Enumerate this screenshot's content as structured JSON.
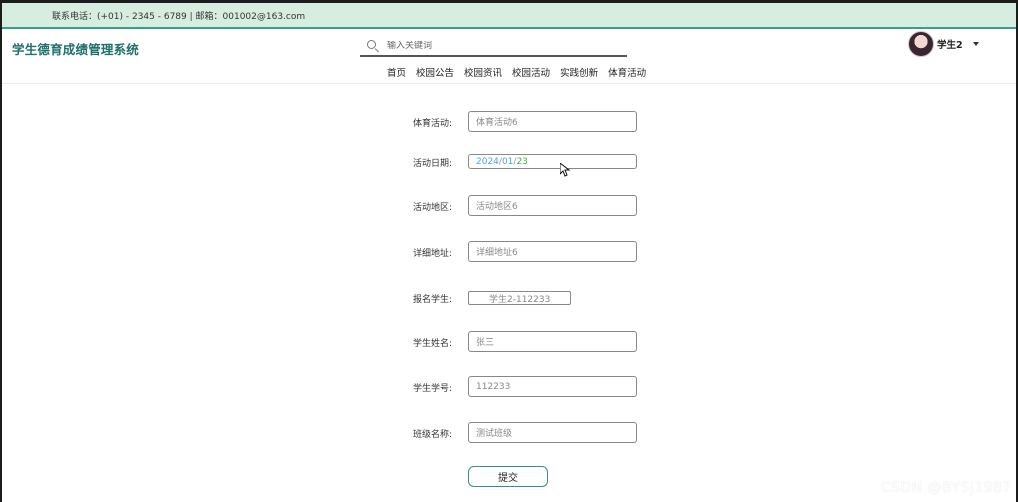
{
  "topbar": {
    "contact": "联系电话：(+01) - 2345 - 6789 | 邮箱：001002@163.com"
  },
  "header": {
    "logo": "学生德育成绩管理系统",
    "search_placeholder": "输入关键词",
    "username": "学生2"
  },
  "nav": [
    "首页",
    "校园公告",
    "校园资讯",
    "校园活动",
    "实践创新",
    "体育活动"
  ],
  "form": {
    "fields": [
      {
        "label": "体育活动:",
        "value": "体育活动6"
      },
      {
        "label": "活动日期:",
        "date": {
          "year": "2024",
          "sep1": "/",
          "month": "01",
          "sep2": "/",
          "day": "23"
        }
      },
      {
        "label": "活动地区:",
        "value": "活动地区6"
      },
      {
        "label": "详细地址:",
        "value": "详细地址6"
      },
      {
        "label": "报名学生:",
        "value": "学生2-112233"
      },
      {
        "label": "学生姓名:",
        "value": "张三"
      },
      {
        "label": "学生学号:",
        "value": "112233"
      },
      {
        "label": "班级名称:",
        "value": "测试班级"
      }
    ],
    "submit_label": "提交"
  },
  "watermark": "CSDN @BYSJ1987",
  "colors": {
    "topbar_bg": "#d6eedf",
    "accent": "#3a9d8f",
    "logo": "#1f6f6a"
  }
}
